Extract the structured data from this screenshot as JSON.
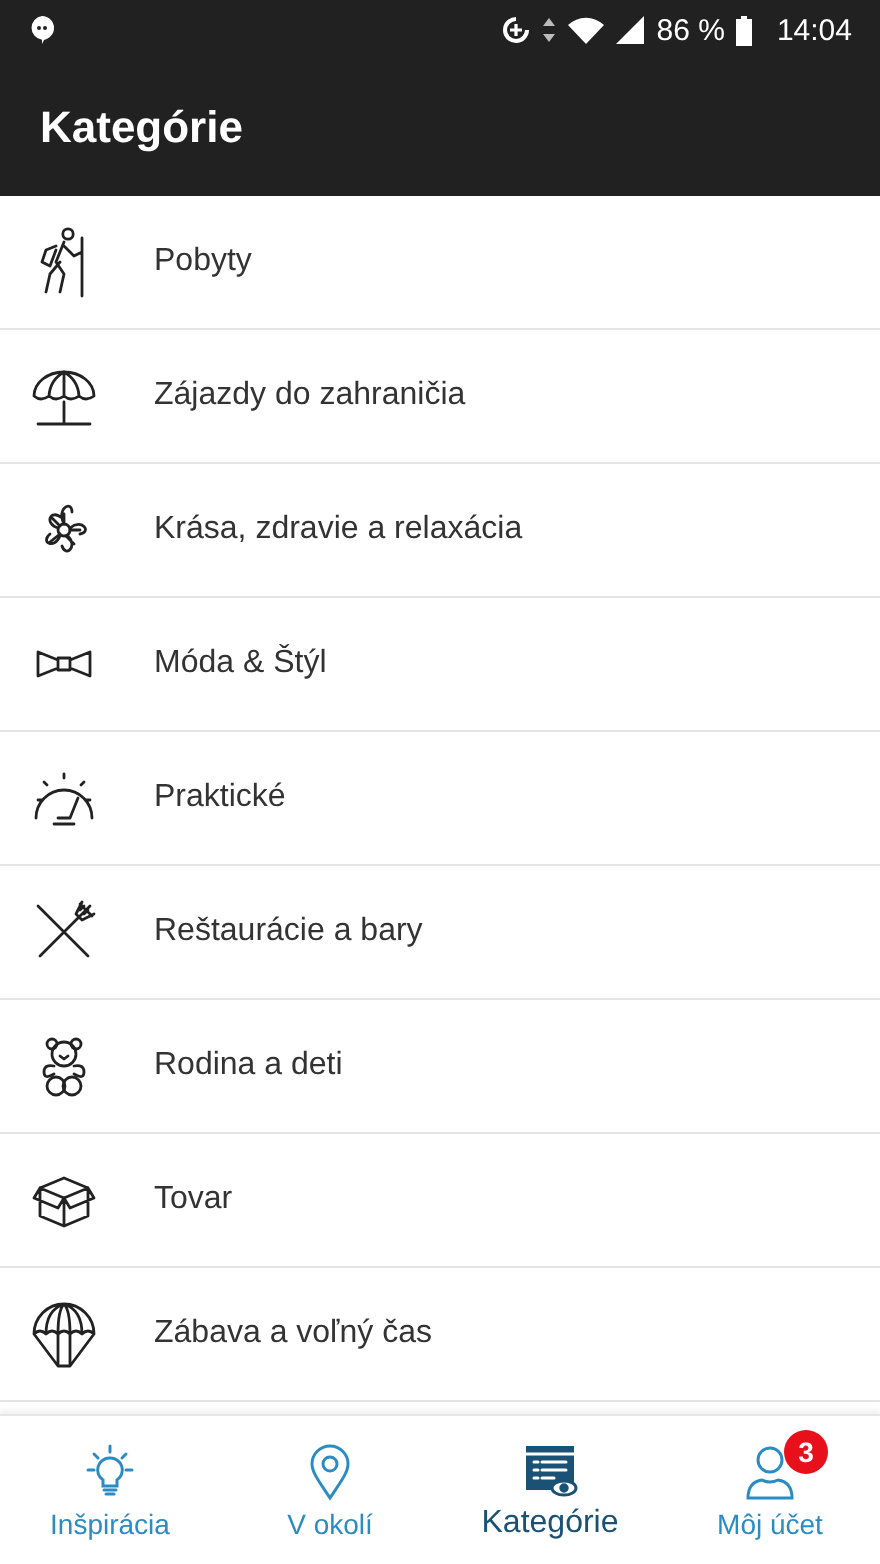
{
  "status_bar": {
    "battery": "86 %",
    "time": "14:04"
  },
  "app_bar": {
    "title": "Kategórie"
  },
  "categories": [
    {
      "label": "Pobyty"
    },
    {
      "label": "Zájazdy do zahraničia"
    },
    {
      "label": "Krása, zdravie a relaxácia"
    },
    {
      "label": "Móda & Štýl"
    },
    {
      "label": "Praktické"
    },
    {
      "label": "Reštaurácie a bary"
    },
    {
      "label": "Rodina a deti"
    },
    {
      "label": "Tovar"
    },
    {
      "label": "Zábava a voľný čas"
    }
  ],
  "bottom_nav": [
    {
      "label": "Inšpirácia",
      "selected": false
    },
    {
      "label": "V okolí",
      "selected": false
    },
    {
      "label": "Kategórie",
      "selected": true
    },
    {
      "label": "Môj účet",
      "selected": false,
      "badge": "3"
    }
  ]
}
